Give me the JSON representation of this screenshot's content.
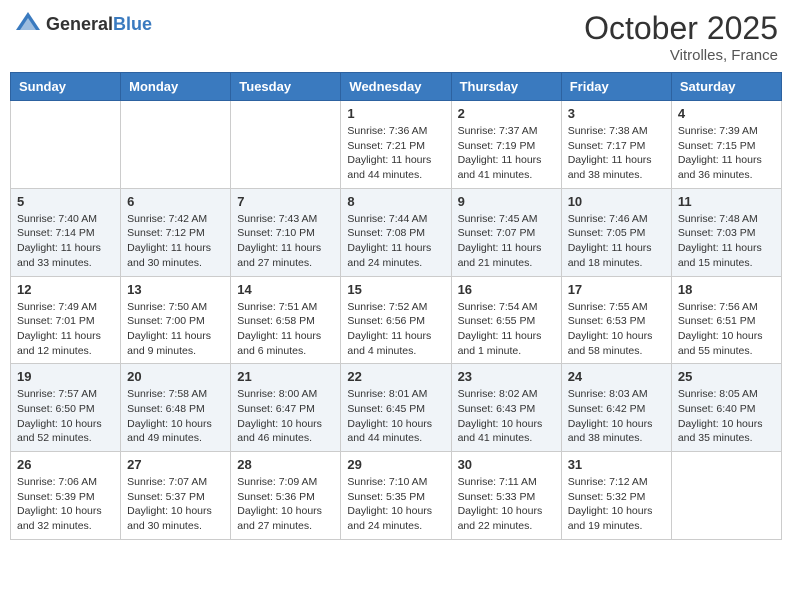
{
  "header": {
    "logo": {
      "text_general": "General",
      "text_blue": "Blue"
    },
    "title": "October 2025",
    "location": "Vitrolles, France"
  },
  "days_of_week": [
    "Sunday",
    "Monday",
    "Tuesday",
    "Wednesday",
    "Thursday",
    "Friday",
    "Saturday"
  ],
  "weeks": [
    {
      "days": [
        {
          "number": "",
          "info": ""
        },
        {
          "number": "",
          "info": ""
        },
        {
          "number": "",
          "info": ""
        },
        {
          "number": "1",
          "info": "Sunrise: 7:36 AM\nSunset: 7:21 PM\nDaylight: 11 hours and 44 minutes."
        },
        {
          "number": "2",
          "info": "Sunrise: 7:37 AM\nSunset: 7:19 PM\nDaylight: 11 hours and 41 minutes."
        },
        {
          "number": "3",
          "info": "Sunrise: 7:38 AM\nSunset: 7:17 PM\nDaylight: 11 hours and 38 minutes."
        },
        {
          "number": "4",
          "info": "Sunrise: 7:39 AM\nSunset: 7:15 PM\nDaylight: 11 hours and 36 minutes."
        }
      ]
    },
    {
      "days": [
        {
          "number": "5",
          "info": "Sunrise: 7:40 AM\nSunset: 7:14 PM\nDaylight: 11 hours and 33 minutes."
        },
        {
          "number": "6",
          "info": "Sunrise: 7:42 AM\nSunset: 7:12 PM\nDaylight: 11 hours and 30 minutes."
        },
        {
          "number": "7",
          "info": "Sunrise: 7:43 AM\nSunset: 7:10 PM\nDaylight: 11 hours and 27 minutes."
        },
        {
          "number": "8",
          "info": "Sunrise: 7:44 AM\nSunset: 7:08 PM\nDaylight: 11 hours and 24 minutes."
        },
        {
          "number": "9",
          "info": "Sunrise: 7:45 AM\nSunset: 7:07 PM\nDaylight: 11 hours and 21 minutes."
        },
        {
          "number": "10",
          "info": "Sunrise: 7:46 AM\nSunset: 7:05 PM\nDaylight: 11 hours and 18 minutes."
        },
        {
          "number": "11",
          "info": "Sunrise: 7:48 AM\nSunset: 7:03 PM\nDaylight: 11 hours and 15 minutes."
        }
      ]
    },
    {
      "days": [
        {
          "number": "12",
          "info": "Sunrise: 7:49 AM\nSunset: 7:01 PM\nDaylight: 11 hours and 12 minutes."
        },
        {
          "number": "13",
          "info": "Sunrise: 7:50 AM\nSunset: 7:00 PM\nDaylight: 11 hours and 9 minutes."
        },
        {
          "number": "14",
          "info": "Sunrise: 7:51 AM\nSunset: 6:58 PM\nDaylight: 11 hours and 6 minutes."
        },
        {
          "number": "15",
          "info": "Sunrise: 7:52 AM\nSunset: 6:56 PM\nDaylight: 11 hours and 4 minutes."
        },
        {
          "number": "16",
          "info": "Sunrise: 7:54 AM\nSunset: 6:55 PM\nDaylight: 11 hours and 1 minute."
        },
        {
          "number": "17",
          "info": "Sunrise: 7:55 AM\nSunset: 6:53 PM\nDaylight: 10 hours and 58 minutes."
        },
        {
          "number": "18",
          "info": "Sunrise: 7:56 AM\nSunset: 6:51 PM\nDaylight: 10 hours and 55 minutes."
        }
      ]
    },
    {
      "days": [
        {
          "number": "19",
          "info": "Sunrise: 7:57 AM\nSunset: 6:50 PM\nDaylight: 10 hours and 52 minutes."
        },
        {
          "number": "20",
          "info": "Sunrise: 7:58 AM\nSunset: 6:48 PM\nDaylight: 10 hours and 49 minutes."
        },
        {
          "number": "21",
          "info": "Sunrise: 8:00 AM\nSunset: 6:47 PM\nDaylight: 10 hours and 46 minutes."
        },
        {
          "number": "22",
          "info": "Sunrise: 8:01 AM\nSunset: 6:45 PM\nDaylight: 10 hours and 44 minutes."
        },
        {
          "number": "23",
          "info": "Sunrise: 8:02 AM\nSunset: 6:43 PM\nDaylight: 10 hours and 41 minutes."
        },
        {
          "number": "24",
          "info": "Sunrise: 8:03 AM\nSunset: 6:42 PM\nDaylight: 10 hours and 38 minutes."
        },
        {
          "number": "25",
          "info": "Sunrise: 8:05 AM\nSunset: 6:40 PM\nDaylight: 10 hours and 35 minutes."
        }
      ]
    },
    {
      "days": [
        {
          "number": "26",
          "info": "Sunrise: 7:06 AM\nSunset: 5:39 PM\nDaylight: 10 hours and 32 minutes."
        },
        {
          "number": "27",
          "info": "Sunrise: 7:07 AM\nSunset: 5:37 PM\nDaylight: 10 hours and 30 minutes."
        },
        {
          "number": "28",
          "info": "Sunrise: 7:09 AM\nSunset: 5:36 PM\nDaylight: 10 hours and 27 minutes."
        },
        {
          "number": "29",
          "info": "Sunrise: 7:10 AM\nSunset: 5:35 PM\nDaylight: 10 hours and 24 minutes."
        },
        {
          "number": "30",
          "info": "Sunrise: 7:11 AM\nSunset: 5:33 PM\nDaylight: 10 hours and 22 minutes."
        },
        {
          "number": "31",
          "info": "Sunrise: 7:12 AM\nSunset: 5:32 PM\nDaylight: 10 hours and 19 minutes."
        },
        {
          "number": "",
          "info": ""
        }
      ]
    }
  ]
}
